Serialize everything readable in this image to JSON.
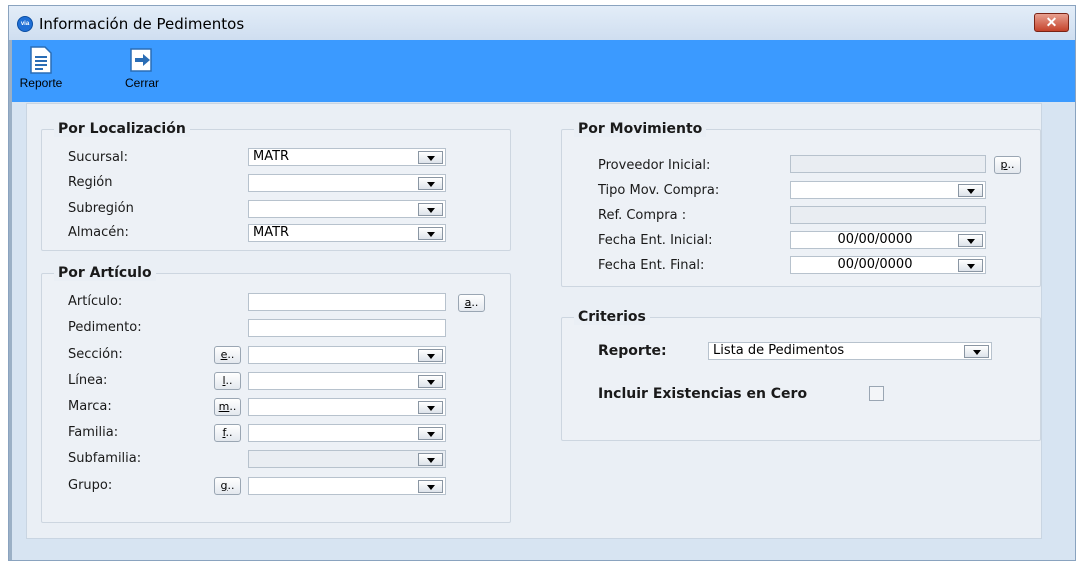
{
  "window": {
    "title": "Información de Pedimentos",
    "close_label": "✕",
    "app_icon_text": "via"
  },
  "toolbar": {
    "reporte_label": "Reporte",
    "cerrar_label": "Cerrar"
  },
  "localizacion": {
    "title": "Por Localización",
    "sucursal_label": "Sucursal:",
    "sucursal_value": "MATR",
    "region_label": "Región",
    "region_value": "",
    "subregion_label": "Subregión",
    "subregion_value": "",
    "almacen_label": "Almacén:",
    "almacen_value": "MATR"
  },
  "articulo": {
    "title": "Por Artículo",
    "articulo_label": "Artículo:",
    "articulo_value": "",
    "articulo_btn": "a",
    "pedimento_label": "Pedimento:",
    "pedimento_value": "",
    "seccion_label": "Sección:",
    "seccion_btn": "e",
    "seccion_value": "",
    "linea_label": "Línea:",
    "linea_btn": "l",
    "linea_value": "",
    "marca_label": "Marca:",
    "marca_btn": "m",
    "marca_value": "",
    "familia_label": "Familia:",
    "familia_btn": "f",
    "familia_value": "",
    "subfamilia_label": "Subfamilia:",
    "subfamilia_value": "",
    "grupo_label": "Grupo:",
    "grupo_btn": "g",
    "grupo_value": ""
  },
  "movimiento": {
    "title": "Por Movimiento",
    "proveedor_label": "Proveedor Inicial:",
    "proveedor_value": "",
    "proveedor_btn": "p",
    "tipo_label": "Tipo Mov. Compra:",
    "tipo_value": "",
    "ref_label": "Ref. Compra :",
    "ref_value": "",
    "fecha_ini_label": "Fecha Ent. Inicial:",
    "fecha_ini_value": "00/00/0000",
    "fecha_fin_label": "Fecha Ent. Final:",
    "fecha_fin_value": "00/00/0000"
  },
  "criterios": {
    "title": "Criterios",
    "reporte_label": "Reporte:",
    "reporte_value": "Lista de Pedimentos",
    "incluir_label": "Incluir Existencias en Cero",
    "incluir_checked": false
  },
  "colors": {
    "toolbar": "#3b9aff",
    "window_bg": "#d7e4f2",
    "close": "#c4432b"
  },
  "icons": {
    "reporte": "report-document-icon",
    "cerrar": "exit-arrow-icon"
  }
}
